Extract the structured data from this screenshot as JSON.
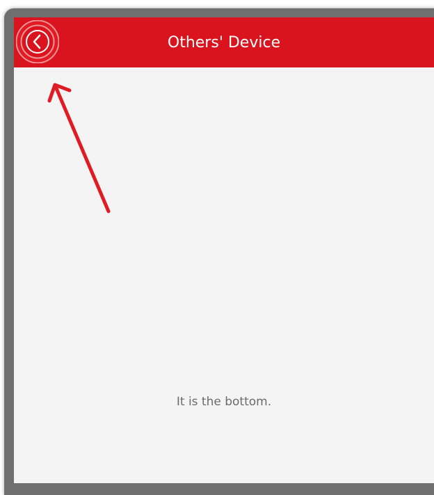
{
  "header": {
    "title": "Others' Device",
    "back_icon": "chevron-left-icon",
    "bar_color": "#d9141e"
  },
  "main": {
    "footer_text": "It is the bottom.",
    "background_color": "#f4f4f4"
  },
  "annotation": {
    "highlight_color": "#e01b24",
    "target": "back-button"
  }
}
